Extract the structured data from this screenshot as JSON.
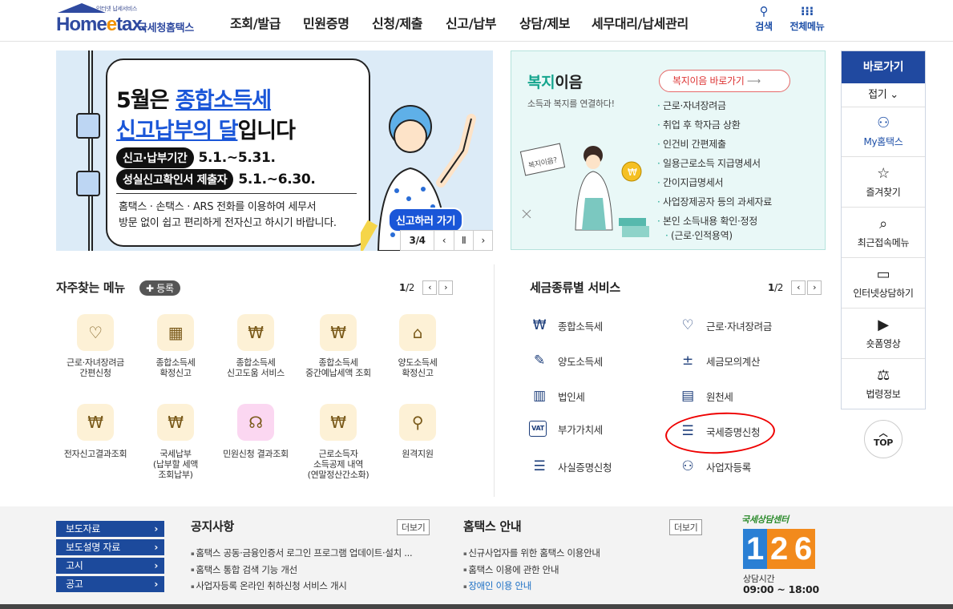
{
  "header": {
    "logo_tagline": "인터넷 납세서비스",
    "logo_word": "Home",
    "logo_word_e": "e",
    "logo_word_end": "tax.",
    "logo_kr": "국세청홈택스",
    "nav": [
      "조회/발급",
      "민원증명",
      "신청/제출",
      "신고/납부",
      "상담/제보",
      "세무대리/납세관리"
    ],
    "search_label": "검색",
    "all_menu_label": "전체메뉴"
  },
  "banner": {
    "line1_a": "5월은 ",
    "line1_b": "종합소득세",
    "line2_a": "신고납부의 달",
    "line2_b": "입니다",
    "period_label": "신고·납부기간",
    "period_dates": "5.1.~5.31.",
    "confirm_label": "성실신고확인서 제출자",
    "confirm_dates": "5.1.~6.30.",
    "body1": "홈택스 · 손택스 · ARS 전화를 이용하여 세무서",
    "body2": "방문 없이 쉽고 편리하게 전자신고 하시기 바랍니다.",
    "cta": "신고하러 가기",
    "page": "3/4",
    "prev": "‹",
    "pause": "Ⅱ",
    "next": "›"
  },
  "welfare": {
    "title_a": "복지",
    "title_b": "이음",
    "subtitle": "소득과 복지를 연결하다!",
    "go_label": "복지이음 바로가기",
    "go_arrow": "⟶",
    "items": [
      "근로·자녀장려금",
      "취업 후 학자금 상환",
      "인건비 간편제출",
      "일용근로소득 지급명세서",
      "간이지급명세서",
      "사업장제공자 등의 과세자료",
      "본인 소득내용 확인·정정",
      "(근로·인적용역)"
    ],
    "illu_sign": "복지이음?"
  },
  "quick": {
    "title": "바로가기",
    "fold": "접기 ⌄",
    "items": [
      {
        "label": "My홈택스",
        "icon": "person-icon",
        "glyph": "⚇"
      },
      {
        "label": "즐겨찾기",
        "icon": "star-icon",
        "glyph": "☆"
      },
      {
        "label": "최근접속메뉴",
        "icon": "recent-icon",
        "glyph": "⌕"
      },
      {
        "label": "인터넷상담하기",
        "icon": "laptop-icon",
        "glyph": "▭"
      },
      {
        "label": "숏폼영상",
        "icon": "play-icon",
        "glyph": "▶"
      },
      {
        "label": "법령정보",
        "icon": "gavel-icon",
        "glyph": "⚖"
      }
    ],
    "top_arrow": "︿",
    "top": "TOP"
  },
  "frequent": {
    "title": "자주찾는 메뉴",
    "add_label": "✚ 등록",
    "page_cur": "1",
    "page_total": "/2",
    "prev": "‹",
    "next": "›",
    "items": [
      {
        "l1": "근로·자녀장려금",
        "l2": "간편신청",
        "l3": "",
        "glyph": "♡",
        "bg": "#fdf1d6"
      },
      {
        "l1": "종합소득세",
        "l2": "확정신고",
        "l3": "",
        "glyph": "▦",
        "bg": "#fdf1d6"
      },
      {
        "l1": "종합소득세",
        "l2": "신고도움 서비스",
        "l3": "",
        "glyph": "₩",
        "bg": "#fdf1d6"
      },
      {
        "l1": "종합소득세",
        "l2": "중간예납세액 조회",
        "l3": "",
        "glyph": "₩",
        "bg": "#fdf1d6"
      },
      {
        "l1": "양도소득세",
        "l2": "확정신고",
        "l3": "",
        "glyph": "⌂",
        "bg": "#fdf1d6"
      },
      {
        "l1": "전자신고결과조회",
        "l2": "",
        "l3": "",
        "glyph": "₩",
        "bg": "#fdf1d6"
      },
      {
        "l1": "국세납부",
        "l2": "(납부할 세액",
        "l3": "조회납부)",
        "glyph": "₩",
        "bg": "#fdf1d6"
      },
      {
        "l1": "민원신청 결과조회",
        "l2": "",
        "l3": "",
        "glyph": "☊",
        "bg": "#fbd7f1"
      },
      {
        "l1": "근로소득자",
        "l2": "소득공제 내역",
        "l3": "(연말정산간소화)",
        "glyph": "₩",
        "bg": "#fdf1d6"
      },
      {
        "l1": "원격지원",
        "l2": "",
        "l3": "",
        "glyph": "⚲",
        "bg": "#fdf1d6"
      }
    ]
  },
  "taxsvc": {
    "title": "세금종류별 서비스",
    "page_cur": "1",
    "page_total": "/2",
    "prev": "‹",
    "next": "›",
    "left": [
      {
        "label": "종합소득세",
        "glyph": "₩"
      },
      {
        "label": "양도소득세",
        "glyph": "✎"
      },
      {
        "label": "법인세",
        "glyph": "▥"
      },
      {
        "label": "부가가치세",
        "glyph": "VAT"
      },
      {
        "label": "사실증명신청",
        "glyph": "☰"
      }
    ],
    "right": [
      {
        "label": "근로·자녀장려금",
        "glyph": "♡"
      },
      {
        "label": "세금모의계산",
        "glyph": "±"
      },
      {
        "label": "원천세",
        "glyph": "▤"
      },
      {
        "label": "국세증명신청",
        "glyph": "☰"
      },
      {
        "label": "사업자등록",
        "glyph": "⚇"
      }
    ]
  },
  "footer": {
    "buttons": [
      "보도자료",
      "보도설명 자료",
      "고시",
      "공고"
    ],
    "notice_title": "공지사항",
    "more": "더보기",
    "notices": [
      "홈택스 공동·금융인증서 로그인 프로그램 업데이트·설치 ...",
      "홈택스 통합 검색 기능 개선",
      "사업자등록 온라인 취하신청 서비스 개시"
    ],
    "guide_title": "홈택스 안내",
    "guides": [
      "신규사업자를 위한 홈택스 이용안내",
      "홈택스 이용에 관한 안내",
      "장애인 이용 안내"
    ],
    "cc_title": "국세상담센터",
    "cc_digits": [
      "1",
      "2",
      "6"
    ],
    "cc_hours_label": "상담시간",
    "cc_hours": "09:00 ~ 18:00"
  },
  "colors": {
    "brand": "#2f4aa0",
    "accent": "#1a56d8",
    "welfare": "#15a58e",
    "highlight_circle": "#e00000"
  }
}
